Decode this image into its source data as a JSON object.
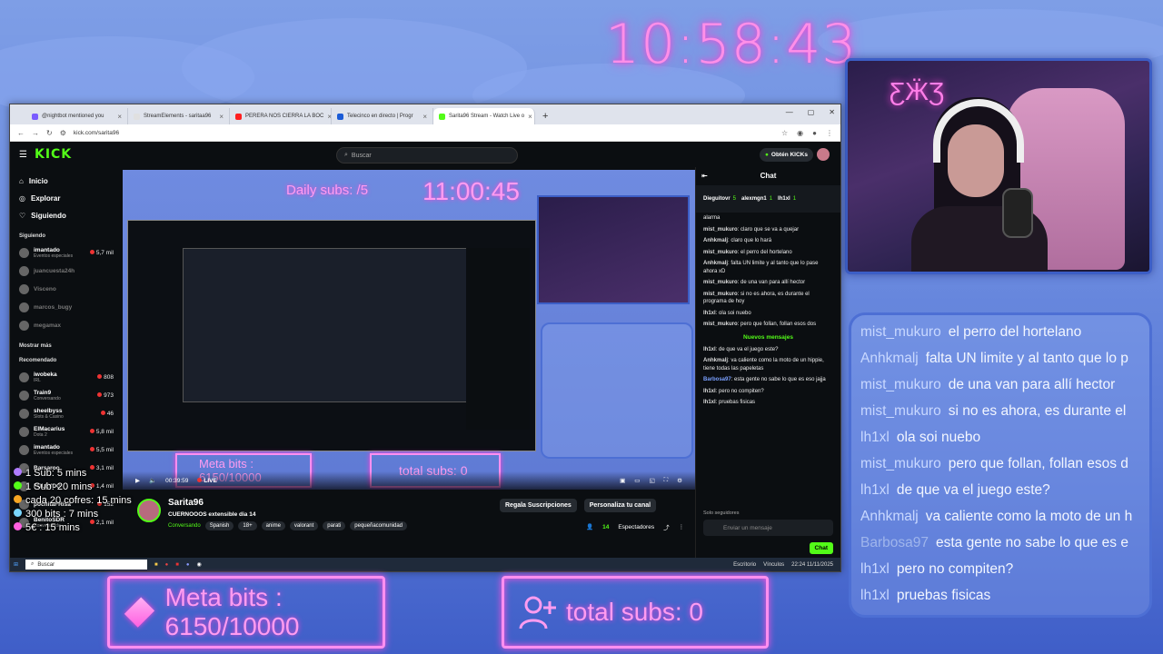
{
  "clock": "10:58:43",
  "overlay_chat": [
    {
      "user": "mist_mukuro",
      "text": "el perro del hortelano"
    },
    {
      "user": "Anhkmalj",
      "text": "falta UN limite y al tanto que lo p"
    },
    {
      "user": "mist_mukuro",
      "text": "de una van para allí hector"
    },
    {
      "user": "mist_mukuro",
      "text": "si no es ahora, es durante el"
    },
    {
      "user": "lh1xl",
      "text": "ola soi nuebo"
    },
    {
      "user": "mist_mukuro",
      "text": "pero que follan, follan esos d"
    },
    {
      "user": "lh1xl",
      "text": "de que va el juego este?"
    },
    {
      "user": "Anhkmalj",
      "text": "va caliente como la moto de un h"
    },
    {
      "user": "Barbosa97",
      "text": "esta gente no sabe lo que es e"
    },
    {
      "user": "lh1xl",
      "text": "pero no compiten?"
    },
    {
      "user": "lh1xl",
      "text": "pruebas fisicas"
    }
  ],
  "meta_bits": "Meta bits : 6150/10000",
  "total_subs": "total subs: 0",
  "rewards": [
    "1 Sub: 5 mins",
    "1 Sub: 20 mins",
    "cada 20 cofres: 15 mins",
    "300 bits : 7 mins",
    "5€ : 15 mins"
  ],
  "browser": {
    "tabs": [
      {
        "title": "@nightbot mentioned you",
        "color": "#7a5cff"
      },
      {
        "title": "StreamElements - saritaa96",
        "color": "#e0e0e0"
      },
      {
        "title": "PERERA NOS CIERRA LA BOC",
        "color": "#ff2020"
      },
      {
        "title": "Telecinco en directo | Progr",
        "color": "#1a5bd6"
      },
      {
        "title": "Sarita96 Stream - Watch Live o",
        "color": "#53fc18",
        "active": true
      }
    ],
    "url": "kick.com/sarita96",
    "search_placeholder": "Buscar",
    "get_kicks": "Obtén KICKs",
    "nav": [
      "Inicio",
      "Explorar",
      "Siguiendo"
    ],
    "following_header": "Siguiendo",
    "following": [
      {
        "name": "imantado",
        "cat": "Eventos especiales",
        "viewers": "5,7 mil",
        "live": true
      },
      {
        "name": "juancuesta24h",
        "cat": "",
        "viewers": "",
        "live": false
      },
      {
        "name": "Visceno",
        "cat": "",
        "viewers": "",
        "live": false
      },
      {
        "name": "marcos_bugy",
        "cat": "",
        "viewers": "",
        "live": false
      },
      {
        "name": "megamax",
        "cat": "",
        "viewers": "",
        "live": false
      }
    ],
    "show_more": "Mostrar más",
    "recommended_header": "Recomendado",
    "recommended": [
      {
        "name": "iwobeka",
        "cat": "IRL",
        "viewers": "808"
      },
      {
        "name": "Train9",
        "cat": "Conversando",
        "viewers": "973"
      },
      {
        "name": "sheelbyss",
        "cat": "Slots & Casino",
        "viewers": "46"
      },
      {
        "name": "ElMacarius",
        "cat": "Dota 2",
        "viewers": "5,8 mil"
      },
      {
        "name": "imantado",
        "cat": "Eventos especiales",
        "viewers": "5,5 mil"
      },
      {
        "name": "Barsaroo",
        "cat": "",
        "viewers": "3,1 mil"
      },
      {
        "name": "FULLYDG",
        "cat": "",
        "viewers": "1,4 mil"
      },
      {
        "name": "pochitaFRisa",
        "cat": "",
        "viewers": "152"
      },
      {
        "name": "BenitoSDR",
        "cat": "Conversando",
        "viewers": "2,1 mil"
      }
    ],
    "video_time": "00:39:59",
    "video_live": "LIVE",
    "streamer": "Sarita96",
    "stream_title": "CUERNOOOS extensible dia 14",
    "category": "Conversando",
    "tags": [
      "Spanish",
      "18+",
      "anime",
      "valorant",
      "parati",
      "pequeñacomunidad"
    ],
    "btn_gift": "Regala Suscripciones",
    "btn_customize": "Personaliza tu canal",
    "viewers": "14",
    "viewers_label": "Espectadores",
    "chat_title": "Chat",
    "pinned": [
      {
        "name": "Dieguitovr",
        "n": "5"
      },
      {
        "name": "alexmgn1",
        "n": "1"
      },
      {
        "name": "lh1xl",
        "n": "1"
      }
    ],
    "chat_messages": [
      {
        "user": "",
        "text": "alarma"
      },
      {
        "user": "mist_mukuro",
        "text": "claro que se va a quejar"
      },
      {
        "user": "Anhkmalj",
        "text": "claro que lo hará"
      },
      {
        "user": "mist_mukuro",
        "text": "el perro del hortelano"
      },
      {
        "user": "Anhkmalj",
        "text": "falta UN limite y al tanto que lo pase ahora xD"
      },
      {
        "user": "mist_mukuro",
        "text": "de una van para allí hector"
      },
      {
        "user": "mist_mukuro",
        "text": "si no es ahora, es durante el programa de hoy"
      },
      {
        "user": "lh1xl",
        "text": "ola soi nuebo"
      },
      {
        "user": "mist_mukuro",
        "text": "pero que follan, follan esos dos"
      }
    ],
    "new_messages": "Nuevos mensajes",
    "chat_messages2": [
      {
        "user": "lh1xl",
        "text": "de que va el juego este?"
      },
      {
        "user": "Anhkmalj",
        "text": "va caliente como la moto de un hippie, tiene todas las papeletas"
      },
      {
        "user": "Barbosa97",
        "text": "esta gente no sabe lo que es eso jajja"
      },
      {
        "user": "lh1xl",
        "text": "pero no compiten?"
      },
      {
        "user": "lh1xl",
        "text": "pruebas fisicas"
      }
    ],
    "chat_mode": "Solo seguidores",
    "chat_placeholder": "Enviar un mensaje",
    "chat_send": "Chat",
    "taskbar_search": "Buscar",
    "taskbar_right": [
      "Escritorio",
      "Vínculos",
      "22:24 11/11/2025"
    ]
  }
}
